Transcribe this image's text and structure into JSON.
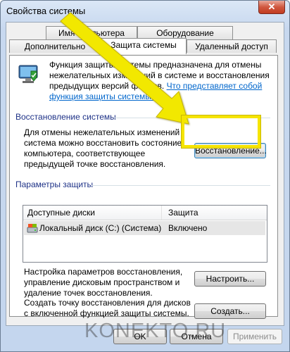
{
  "window": {
    "title": "Свойства системы",
    "close_glyph": "✕"
  },
  "tabs_top": [
    "Имя компьютера",
    "Оборудование"
  ],
  "tabs_bottom": [
    "Дополнительно",
    "Защита системы",
    "Удаленный доступ"
  ],
  "description": {
    "text": "Функция защиты системы предназначена для отмены нежелательных изменений в системе и восстановления предыдущих версий файлов.",
    "link": "Что представляет собой функция защиты системы?"
  },
  "restore_group": {
    "label": "Восстановление системы",
    "text": "Для отмены нежелательных изменений система можно восстановить состояние компьютера, соответствующее предыдущей точке восстановления.",
    "button": "Восстановление..."
  },
  "protection_group": {
    "label": "Параметры защиты",
    "columns": [
      "Доступные диски",
      "Защита"
    ],
    "rows": [
      {
        "disk": "Локальный диск (C:) (Система)",
        "status": "Включено",
        "icon": "hard-drive-icon"
      }
    ],
    "configure_text": "Настройка параметров восстановления, управление дисковым пространством и удаление точек восстановления.",
    "configure_button": "Настроить...",
    "create_text": "Создать точку восстановления для дисков с включенной функцией защиты системы.",
    "create_button": "Создать..."
  },
  "footer": {
    "ok": "OK",
    "cancel": "Отмена",
    "apply": "Применить"
  },
  "watermark": "KONEKTO.RU",
  "colors": {
    "highlight": "#f5e400",
    "arrow": "#f2e800",
    "link": "#0066cc"
  }
}
